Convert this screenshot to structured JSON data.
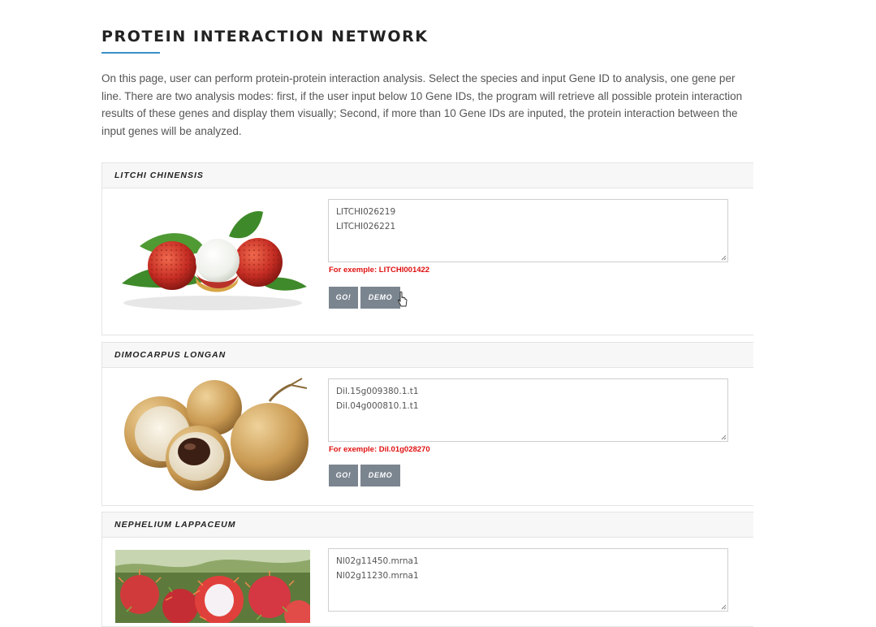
{
  "page": {
    "title": "PROTEIN INTERACTION NETWORK",
    "intro": "On this page, user can perform protein-protein interaction analysis. Select the species and input Gene ID to analysis, one gene per line. There are two analysis modes: first, if the user input below 10 Gene IDs, the program will retrieve all possible protein interaction results of these genes and display them visually; Second, if more than 10 Gene IDs are inputed, the protein interaction between the input genes will be analyzed."
  },
  "species": [
    {
      "name": "LITCHI CHINENSIS",
      "input_value": "LITCHI026219\nLITCHI026221",
      "example": "For exemple: LITCHI001422",
      "go_label": "GO!",
      "demo_label": "DEMO"
    },
    {
      "name": "DIMOCARPUS LONGAN",
      "input_value": "Dil.15g009380.1.t1\nDil.04g000810.1.t1",
      "example": "For exemple: Dil.01g028270",
      "go_label": "GO!",
      "demo_label": "DEMO"
    },
    {
      "name": "NEPHELIUM LAPPACEUM",
      "input_value": "Nl02g11450.mrna1\nNl02g11230.mrna1"
    }
  ],
  "colors": {
    "accent": "#3a8fc8",
    "example_text": "#e01010",
    "button_bg": "#7b8590",
    "panel_header_bg": "#f7f7f7"
  }
}
